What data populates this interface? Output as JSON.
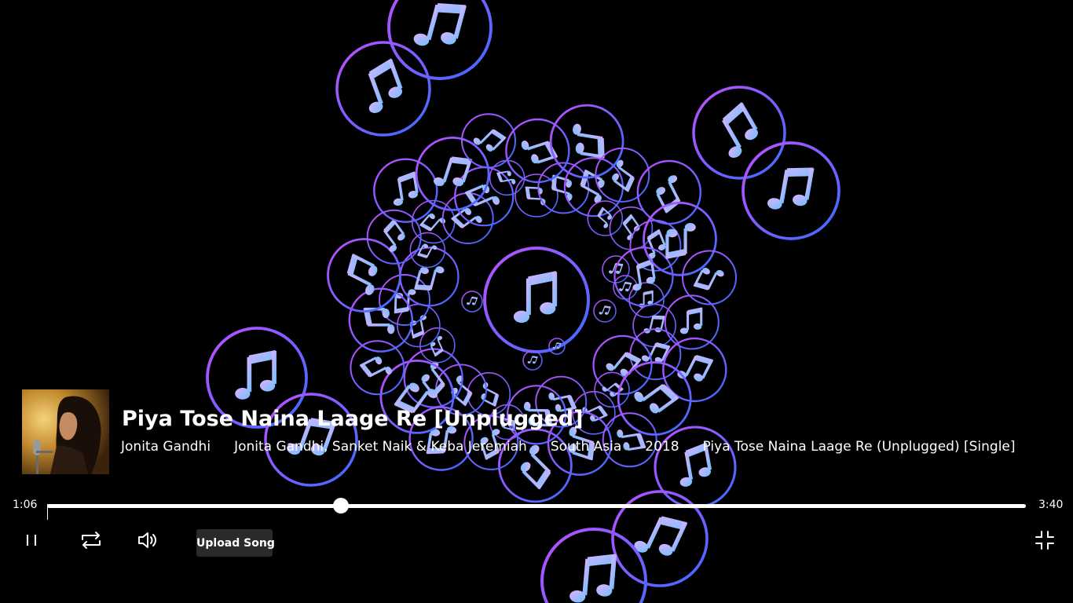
{
  "track": {
    "title": "Piya Tose Naina Laage Re [Unplugged]",
    "meta": [
      "Jonita Gandhi",
      "Jonita Gandhi, Sanket Naik & Keba Jeremiah",
      "South Asia",
      "2018",
      "Piya Tose Naina Laage Re (Unplugged) [Single]"
    ]
  },
  "player": {
    "elapsed": "1:06",
    "duration": "3:40",
    "progress": 0.3,
    "upload_label": "Upload Song"
  },
  "icons": {
    "pause": "pause-icon",
    "repeat": "repeat-icon",
    "volume": "volume-icon",
    "fullscreen_exit": "fullscreen-exit-icon",
    "visualizer_note": "music-note-icon"
  },
  "colors": {
    "background": "#000000",
    "gradient_pink": "#c050ff",
    "gradient_blue": "#3a6cff",
    "note_pink": "#e0b0ff",
    "note_blue": "#6cc0ff",
    "upload_bg": "#2a2a2a"
  }
}
